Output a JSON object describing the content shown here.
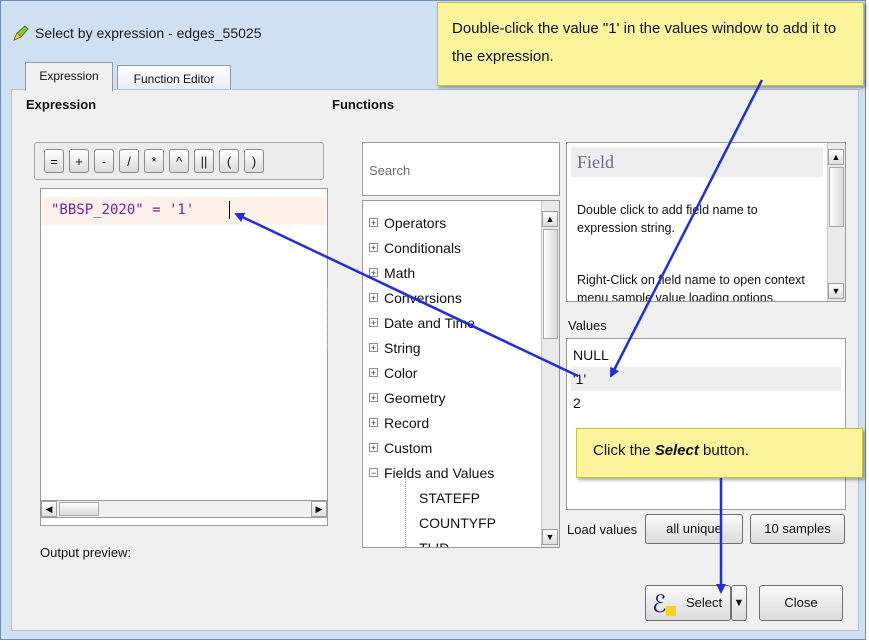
{
  "window": {
    "title": "Select by expression - edges_55025"
  },
  "tabs": [
    {
      "label": "Expression",
      "active": true
    },
    {
      "label": "Function Editor",
      "active": false
    }
  ],
  "expression_panel": {
    "title": "Expression",
    "operators": [
      "=",
      "+",
      "-",
      "/",
      "*",
      "^",
      "||",
      "(",
      ")"
    ],
    "expression_text": "\"BBSP_2020\" = '1'",
    "output_preview_label": "Output preview:"
  },
  "functions_panel": {
    "title": "Functions",
    "search_placeholder": "Search",
    "tree": [
      {
        "label": "Operators",
        "expander": "+"
      },
      {
        "label": "Conditionals",
        "expander": "+"
      },
      {
        "label": "Math",
        "expander": "+"
      },
      {
        "label": "Conversions",
        "expander": "+"
      },
      {
        "label": "Date and Time",
        "expander": "+"
      },
      {
        "label": "String",
        "expander": "+"
      },
      {
        "label": "Color",
        "expander": "+"
      },
      {
        "label": "Geometry",
        "expander": "+"
      },
      {
        "label": "Record",
        "expander": "+"
      },
      {
        "label": "Custom",
        "expander": "+"
      },
      {
        "label": "Fields and Values",
        "expander": "−"
      }
    ],
    "tree_children": [
      "STATEFP",
      "COUNTYFP",
      "TLID"
    ]
  },
  "help": {
    "title": "Field",
    "paragraph1": "Double click to add field name to expression string.",
    "paragraph2": "Right-Click on field name to open context menu sample value loading options."
  },
  "values_panel": {
    "label": "Values",
    "items": [
      "NULL",
      "'1'",
      "2"
    ],
    "selected_index": 1,
    "load_values_label": "Load values",
    "all_unique_label": "all unique",
    "samples_label": "10 samples"
  },
  "buttons": {
    "select_label": "Select",
    "close_label": "Close"
  },
  "callouts": {
    "top": "Double-click the value \"1' in the values window to add it to the expression.",
    "bottom_prefix": "Click the ",
    "bottom_emphasis": "Select",
    "bottom_suffix": " button."
  },
  "colors": {
    "arrow": "#1f2ee0",
    "callout_bg": "#fbf49a",
    "expression_text": "#7a1fa2",
    "help_title": "#6a6a90"
  },
  "icons": {
    "app_icon": "qgis-pencil-icon",
    "expression_icon": "epsilon-icon",
    "dropdown": "triangle-down-icon"
  }
}
